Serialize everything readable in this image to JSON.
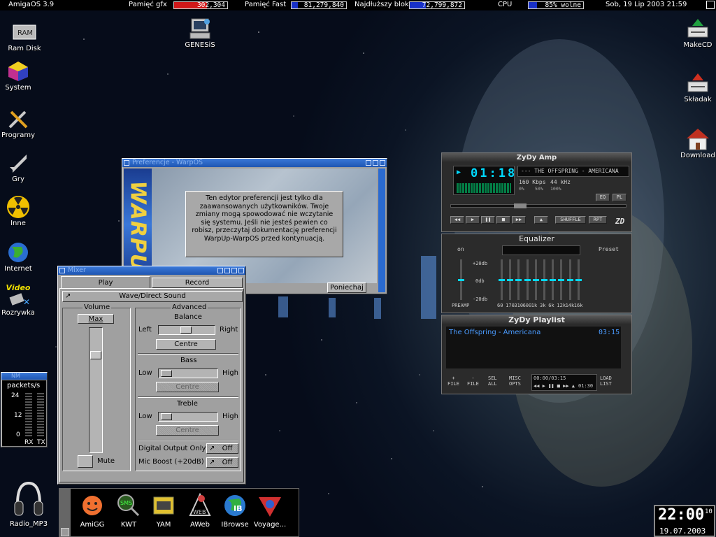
{
  "topbar": {
    "os": "AmigaOS 3.9",
    "gfx_label": "Pamięć gfx",
    "gfx_value": "302,304",
    "fast_label": "Pamięć Fast",
    "fast_value": "81,279,840",
    "block_label": "Najdłuższy blok",
    "block_value": "72,799,872",
    "cpu_label": "CPU",
    "cpu_value": "85% wolne",
    "datetime": "Sob, 19 Lip 2003   21:59",
    "colors": {
      "gfx": "#d01818",
      "fast": "#1830c8",
      "block": "#1830c8",
      "cpu": "#1830c8"
    },
    "gfx_fill": 0.62,
    "fast_fill": 0.12,
    "block_fill": 0.3,
    "cpu_fill": 0.15
  },
  "desktop_icons": [
    {
      "label": "Ram Disk",
      "icon": "ram-disk-icon"
    },
    {
      "label": "System",
      "icon": "system-icon"
    },
    {
      "label": "Programy",
      "icon": "tools-icon"
    },
    {
      "label": "Gry",
      "icon": "jet-icon"
    },
    {
      "label": "Inne",
      "icon": "radiation-icon"
    },
    {
      "label": "Internet",
      "icon": "globe-icon"
    },
    {
      "label": "Rozrywka",
      "icon": "video-icon"
    },
    {
      "label": "GENESiS",
      "icon": "computer-icon"
    },
    {
      "label": "MakeCD",
      "icon": "cd-burner-icon"
    },
    {
      "label": "Składak",
      "icon": "drive-icon"
    },
    {
      "label": "Download",
      "icon": "house-icon"
    },
    {
      "label": "Radio_MP3",
      "icon": "headphones-icon"
    }
  ],
  "video_label": "Video",
  "warpos": {
    "title": "Preferencje - WarpOS",
    "logo": "WARPUP",
    "message": "Ten edytor preferencji jest tylko dla zaawansowanych użytkowników. Twoje zmiany mogą spowodować nie wczytanie się systemu. Jeśli nie jesteś pewien co robisz, przeczytaj dokumentację preferencji WarpUp-WarpOS przed kontynuacją.",
    "cancel": "Poniechaj"
  },
  "mixer": {
    "title": "Mixer",
    "tabs": [
      "Play",
      "Record"
    ],
    "source": "Wave/Direct Sound",
    "volume_label": "Volume",
    "max": "Max",
    "mute": "Mute",
    "volume_level": 0.2,
    "advanced_label": "Advanced",
    "balance": {
      "label": "Balance",
      "left": "Left",
      "right": "Right",
      "centre": "Centre",
      "level": 0.5
    },
    "bass": {
      "label": "Bass",
      "low": "Low",
      "high": "High",
      "centre": "Centre",
      "level": 0.05
    },
    "treble": {
      "label": "Treble",
      "low": "Low",
      "high": "High",
      "centre": "Centre",
      "level": 0.05
    },
    "digital": {
      "label": "Digital Output Only",
      "state": "Off"
    },
    "micboost": {
      "label": "Mic Boost (+20dB)",
      "state": "Off"
    }
  },
  "netmon": {
    "title": "NM",
    "label": "packets/s",
    "ticks": [
      "24",
      "12",
      "0"
    ],
    "rx": "RX",
    "tx": "TX"
  },
  "zydy": {
    "title": "ZyDy Amp",
    "time": "01:18",
    "marquee": "--- THE OFFSPRING - AMERICANA",
    "bitrate": "160 Kbps",
    "freq": "44 kHz",
    "pcts": [
      "0%",
      "50%",
      "100%"
    ],
    "eq": "EQ",
    "pl": "PL",
    "shuffle": "SHUFFLE",
    "rpt": "RPT",
    "logo": "ZD"
  },
  "equalizer": {
    "title": "Equalizer",
    "on": "on",
    "preset": "Preset",
    "db": [
      "+20db",
      "0db",
      "-20db"
    ],
    "preamp": "PREAMP",
    "bands": [
      "60",
      "170",
      "310",
      "600",
      "1k",
      "3k",
      "6k",
      "12k",
      "14k",
      "16k"
    ],
    "values": [
      0,
      0,
      0,
      0,
      0,
      0,
      0,
      0,
      0,
      0
    ],
    "preamp_value": 0
  },
  "playlist": {
    "title": "ZyDy Playlist",
    "tracks": [
      {
        "name": "The Offspring - Americana",
        "len": "03:15"
      }
    ],
    "buttons": [
      [
        "+",
        "FILE"
      ],
      [
        "-",
        "FILE"
      ],
      [
        "SEL",
        "ALL"
      ],
      [
        "MISC",
        "OPTS"
      ],
      [
        "LOAD",
        "LIST"
      ]
    ],
    "progress": "00:00/03:15",
    "time": "01:30"
  },
  "dock": {
    "items": [
      {
        "label": "AmiGG",
        "icon": "sun-face-icon"
      },
      {
        "label": "KWT",
        "icon": "sms-magnifier-icon"
      },
      {
        "label": "YAM",
        "icon": "mailbox-icon"
      },
      {
        "label": "AWeb",
        "icon": "aweb-icon"
      },
      {
        "label": "IBrowse",
        "icon": "ibrowse-icon"
      },
      {
        "label": "Voyage...",
        "icon": "voyager-icon"
      }
    ]
  },
  "clock": {
    "time": "22:00",
    "sec": "10",
    "date": "19.07.2003"
  }
}
